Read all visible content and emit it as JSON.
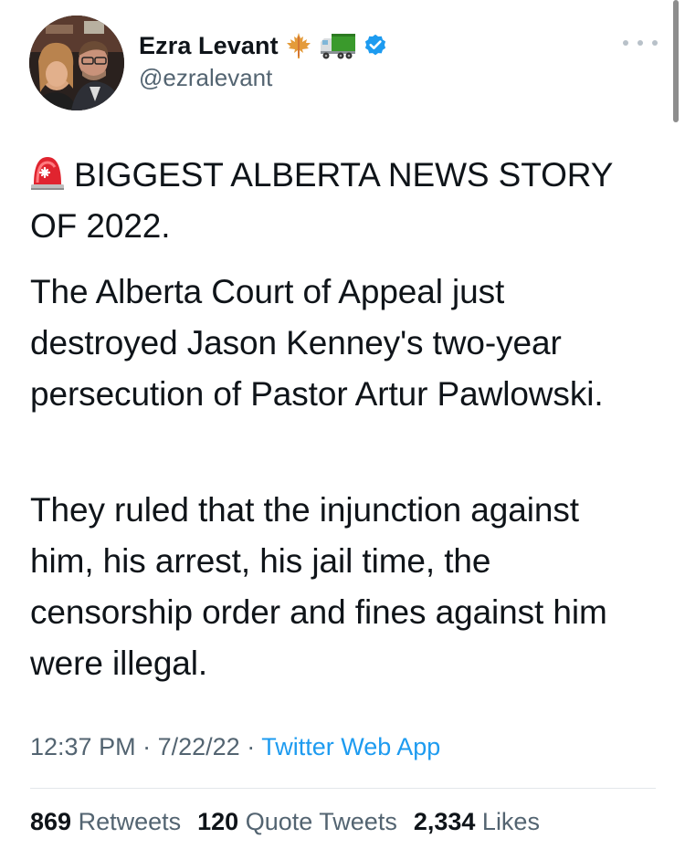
{
  "author": {
    "display_name": "Ezra Levant",
    "handle": "@ezralevant",
    "name_badges": [
      "maple-leaf-icon",
      "truck-icon",
      "verified-badge-icon"
    ]
  },
  "tweet": {
    "paragraphs": [
      "BIGGEST ALBERTA NEWS STORY OF 2022.",
      "The Alberta Court of Appeal just destroyed Jason Kenney's two-year persecution of Pastor Artur Pawlowski.",
      "They ruled that the injunction against him, his arrest, his jail time, the censorship order and fines against him were illegal."
    ],
    "lead_emoji": "siren-icon"
  },
  "meta": {
    "time": "12:37 PM",
    "date": "7/22/22",
    "separator": "·",
    "source": "Twitter Web App"
  },
  "stats": {
    "retweets_count": "869",
    "retweets_label": "Retweets",
    "quotes_count": "120",
    "quotes_label": "Quote Tweets",
    "likes_count": "2,334",
    "likes_label": "Likes"
  },
  "colors": {
    "text": "#0f1419",
    "secondary": "#536471",
    "link": "#1d9bf0",
    "verified": "#1d9bf0",
    "maple": "#e8a33c",
    "truck": "#3d9a2e"
  }
}
